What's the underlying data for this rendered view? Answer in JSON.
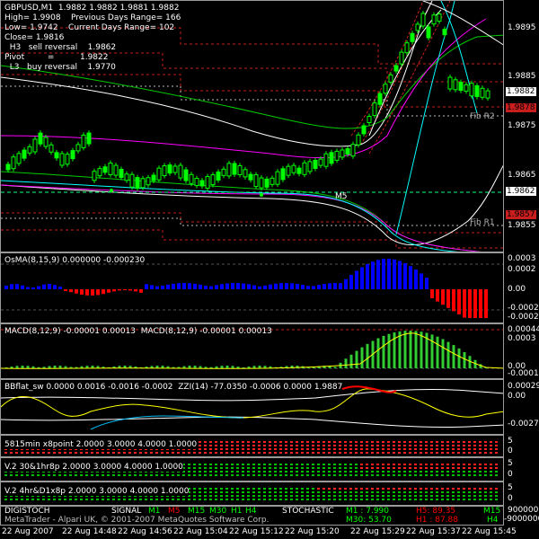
{
  "main": {
    "header_line": "GBPUSD,M1  1.9882 1.9882 1.9881 1.9882",
    "info": [
      "High= 1.9908    Previous Days Range= 166",
      "Low= 1.9742    Current Days Range= 102",
      "Close= 1.9816",
      "  H3   sell reversal    1.9862",
      "Pivot         =          1.9822",
      "  L3   buy reversal    1.9770"
    ],
    "fib_r2": "Fib R2",
    "fib_r1": "Fib R1",
    "m5_label": "M5",
    "axis": [
      "1.9895",
      "1.9885",
      "1.9875",
      "1.9865",
      "1.9855"
    ],
    "tag_bid": "1.9882",
    "tag_r2": "1.9878",
    "tag_mid": "1.9862",
    "tag_r1": "1.9857"
  },
  "osma": {
    "label": "OsMA(8,15,9) 0.000000 -0.000230",
    "axis": [
      "0.0003",
      "0.0002",
      "0.00",
      "-0.0002",
      "-0.00023"
    ]
  },
  "macd": {
    "label": "MACD(8,12,9) -0.00001 0.00013  MACD(8,12,9) -0.00001 0.00013",
    "axis": [
      "0.00044",
      "0.0003",
      "0.00",
      "-0.00012"
    ]
  },
  "bbflat": {
    "label": "BBflat_sw 0.0000 0.0016 -0.0016 -0.0002  ZZI(14) -77.0350 -0.0006 0.0000 1.9887",
    "axis": [
      "0.00029",
      "0.00",
      "-0.0027"
    ]
  },
  "ind1": {
    "label": "5815min x8point 2.0000 3.0000 4.0000 1.0000",
    "axis": [
      "5",
      "0"
    ]
  },
  "ind2": {
    "label": "V.2 30&1hr8p 2.0000 3.0000 4.0000 1.0000",
    "axis": [
      "5",
      "0"
    ]
  },
  "ind3": {
    "label": "V.2 4hr&D1x8p 2.0000 3.0000 4.0000 1.0000",
    "axis": [
      "5",
      "0"
    ]
  },
  "status": {
    "digistoch": "DIGISTOCH",
    "signal": "SIGNAL",
    "tf_m1": "M1",
    "tf_m5": "M5",
    "tf_m15": "M15",
    "tf_m30": "M30",
    "tf_h1": "H1",
    "tf_h4": "H4",
    "copyright": "MetaTrader - Alpari UK, © 2001-2007 MetaQuotes Software Corp.",
    "stochastic": "STOCHASTIC",
    "m1_val": "M1 : 7.990",
    "m30_val": "M30: 53.70",
    "h5_val": "H5: 89.35",
    "h1_val": "H1 : 87.88",
    "r_m15": "M15",
    "r_h4": "H4",
    "axis": [
      "900000",
      "-9000000"
    ]
  },
  "time_labels": [
    "22 Aug 2007",
    "22 Aug 14:48",
    "22 Aug 14:56",
    "22 Aug 15:04",
    "22 Aug 15:12",
    "22 Aug 15:20",
    "22 Aug 15:29",
    "22 Aug 15:37",
    "22 Aug 15:45"
  ],
  "colors": {
    "bull_candle": "#00ff00",
    "bear_candle": "#00ff00",
    "osma_up": "#0000ff",
    "osma_down": "#ff0000",
    "macd_hist": "#32cd32",
    "signal_line": "#ffff00",
    "grid": "#555555"
  }
}
